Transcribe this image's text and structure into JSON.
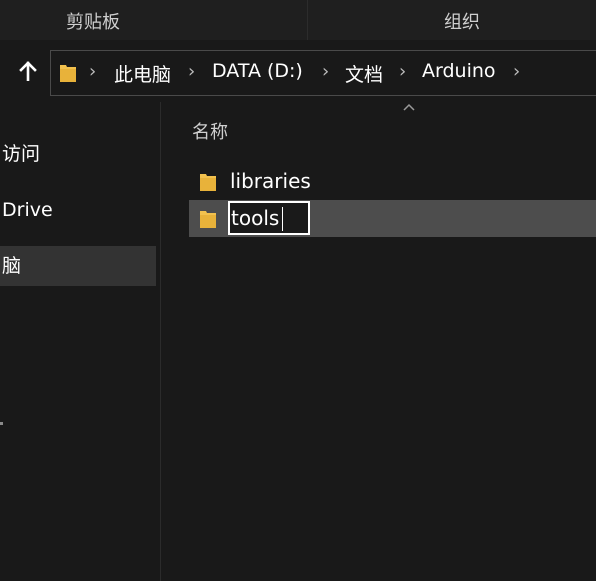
{
  "ribbon": {
    "clipboard_label": "剪贴板",
    "organize_label": "组织"
  },
  "nav": {
    "up_icon": "up-arrow-icon",
    "address_icon": "folder-icon",
    "breadcrumbs": [
      "此电脑",
      "DATA (D:)",
      "文档",
      "Arduino"
    ]
  },
  "sidebar": {
    "items": [
      {
        "label": "访问",
        "selected": false
      },
      {
        "label": "Drive",
        "selected": false
      },
      {
        "label": "脑",
        "selected": true
      }
    ]
  },
  "file_list": {
    "column_name": "名称",
    "files": [
      {
        "name": "libraries",
        "type": "folder",
        "selected": false
      },
      {
        "name": "tools",
        "type": "folder",
        "selected": true,
        "renaming": true
      }
    ]
  },
  "colors": {
    "background": "#191919",
    "selected_row": "#4d4d4d",
    "sidebar_selected": "#333333",
    "folder_yellow": "#f2c14e"
  }
}
